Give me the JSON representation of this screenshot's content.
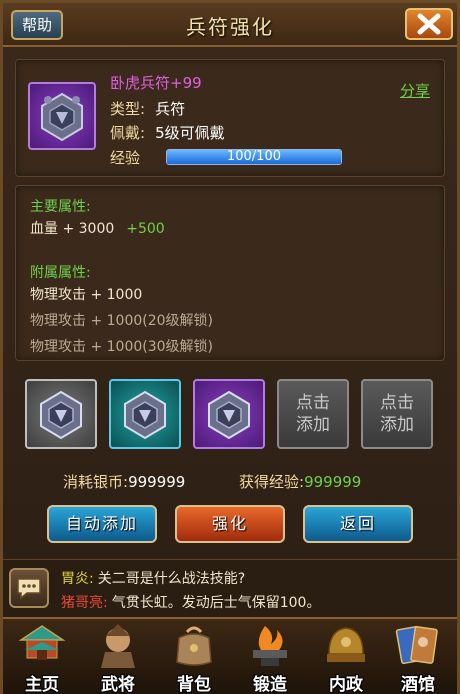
{
  "header": {
    "help_label": "帮助",
    "title": "兵符强化"
  },
  "item": {
    "name": "卧虎兵符+99",
    "type_label": "类型:",
    "type_value": "兵符",
    "wear_label": "佩戴:",
    "wear_value": "5级可佩戴",
    "exp_label": "经验",
    "exp_text": "100/100",
    "exp_progress": 1.0,
    "share_label": "分享"
  },
  "attributes": {
    "main_title": "主要属性:",
    "main_line": "血量 + 3000",
    "main_bonus": "+500",
    "sub_title": "附属属性:",
    "sub_lines": [
      "物理攻击 + 1000",
      "物理攻击 + 1000(20级解锁)",
      "物理攻击 + 1000(30级解锁)"
    ]
  },
  "slots": {
    "empty_label_1": "点击",
    "empty_label_2": "添加"
  },
  "cost": {
    "silver_label": "消耗银币:",
    "silver_value": "999999",
    "exp_label": "获得经验:",
    "exp_value": "999999"
  },
  "buttons": {
    "auto_add": "自动添加",
    "enhance": "强化",
    "back": "返回"
  },
  "chat": {
    "line1_speaker": "胃炎:",
    "line1_msg": "关二哥是什么战法技能?",
    "line2_speaker": "猪哥亮:",
    "line2_msg": "气贯长虹。发动后士气保留100。"
  },
  "nav": {
    "items": [
      "主页",
      "武将",
      "背包",
      "锻造",
      "内政",
      "酒馆"
    ]
  },
  "colors": {
    "accent_green": "#6fd04a",
    "item_name_purple": "#e060e0"
  }
}
